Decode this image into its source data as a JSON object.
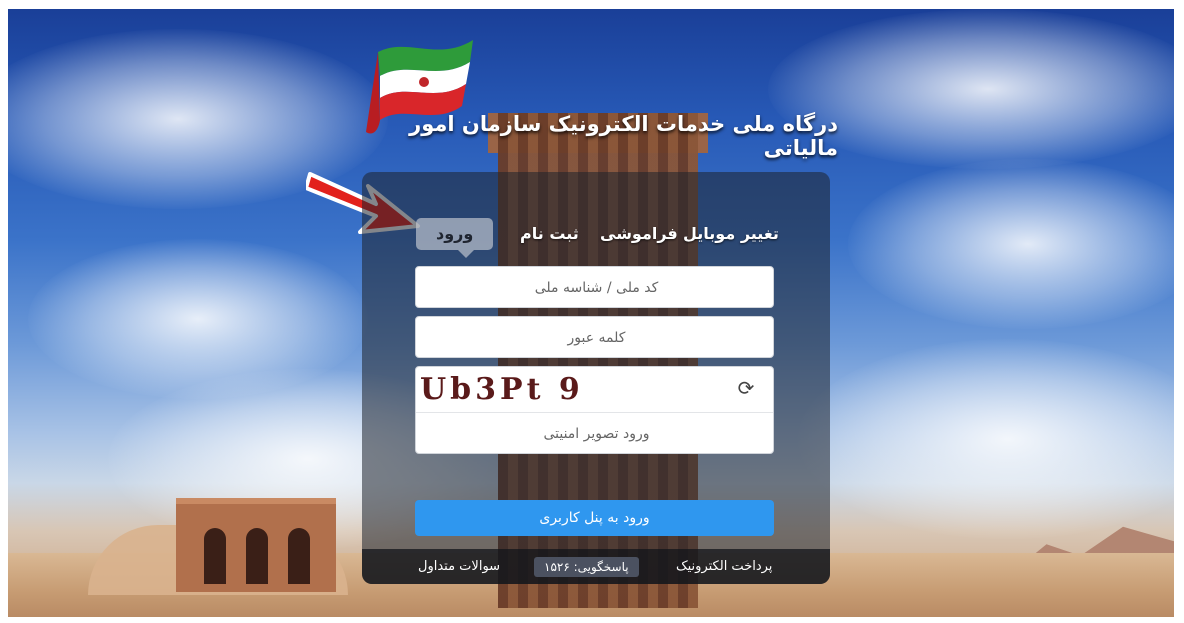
{
  "header": {
    "title": "درگاه ملی خدمات الکترونیک سازمان امور مالیاتی"
  },
  "tabs": [
    {
      "label": "تغییر موبایل"
    },
    {
      "label": "فراموشی"
    },
    {
      "label": "ثبت نام"
    },
    {
      "label": "ورود",
      "active": true
    }
  ],
  "form": {
    "national_id_placeholder": "کد ملی / شناسه ملی",
    "password_placeholder": "کلمه عبور",
    "captcha_text": "Ub3Pt 9",
    "captcha_placeholder": "ورود تصویر امنیتی",
    "submit_label": "ورود به پنل کاربری"
  },
  "footer": {
    "payment": "پرداخت الکترونیک",
    "support": "پاسخگویی: ۱۵۲۶",
    "faq": "سوالات متداول"
  },
  "colors": {
    "accent": "#2f97ef",
    "arrow": "#e2211c"
  },
  "icons": {
    "refresh": "refresh-icon",
    "flag": "iran-flag-icon",
    "arrow": "red-arrow-icon"
  }
}
